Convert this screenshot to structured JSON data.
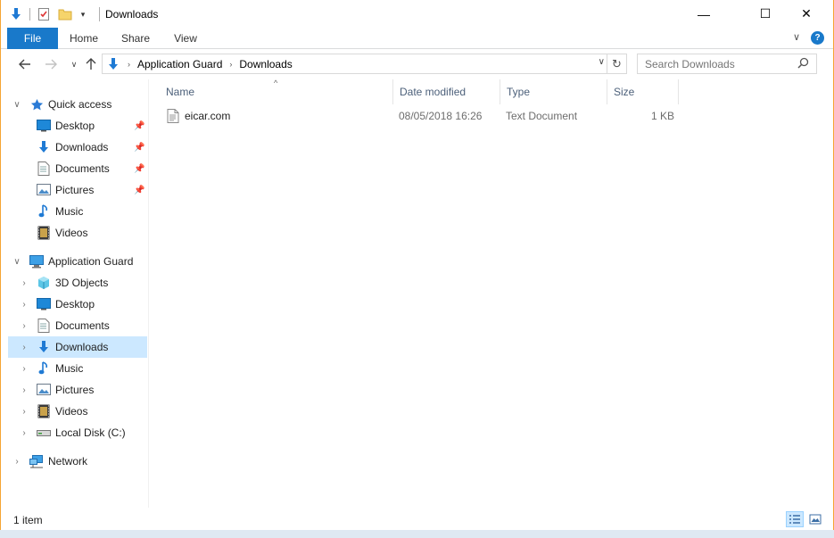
{
  "window": {
    "title": "Downloads",
    "minimize_glyph": "—",
    "maximize_glyph": "☐",
    "close_glyph": "✕"
  },
  "ribbon": {
    "tabs": [
      "File",
      "Home",
      "Share",
      "View"
    ],
    "help_glyph": "?"
  },
  "address": {
    "crumbs": [
      "Application Guard",
      "Downloads"
    ],
    "search_placeholder": "Search Downloads"
  },
  "nav_pane": {
    "quick_access": {
      "label": "Quick access",
      "items": [
        {
          "label": "Desktop",
          "icon": "desktop-icon",
          "pinned": true
        },
        {
          "label": "Downloads",
          "icon": "downloads-icon",
          "pinned": true
        },
        {
          "label": "Documents",
          "icon": "documents-icon",
          "pinned": true
        },
        {
          "label": "Pictures",
          "icon": "pictures-icon",
          "pinned": true
        },
        {
          "label": "Music",
          "icon": "music-icon",
          "pinned": false
        },
        {
          "label": "Videos",
          "icon": "videos-icon",
          "pinned": false
        }
      ]
    },
    "this_pc": {
      "label": "Application Guard",
      "items": [
        {
          "label": "3D Objects",
          "icon": "3d-objects-icon"
        },
        {
          "label": "Desktop",
          "icon": "desktop-icon"
        },
        {
          "label": "Documents",
          "icon": "documents-icon"
        },
        {
          "label": "Downloads",
          "icon": "downloads-icon",
          "selected": true
        },
        {
          "label": "Music",
          "icon": "music-icon"
        },
        {
          "label": "Pictures",
          "icon": "pictures-icon"
        },
        {
          "label": "Videos",
          "icon": "videos-icon"
        },
        {
          "label": "Local Disk (C:)",
          "icon": "drive-icon"
        }
      ]
    },
    "network": {
      "label": "Network"
    }
  },
  "file_list": {
    "columns": [
      "Name",
      "Date modified",
      "Type",
      "Size"
    ],
    "rows": [
      {
        "name": "eicar.com",
        "date_modified": "08/05/2018 16:26",
        "type": "Text Document",
        "size": "1 KB"
      }
    ]
  },
  "status_bar": {
    "item_count": "1 item"
  },
  "colors": {
    "accent": "#1979ca",
    "selection": "#cce8ff",
    "window_border": "#f5a533",
    "column_header_text": "#4c607a"
  }
}
